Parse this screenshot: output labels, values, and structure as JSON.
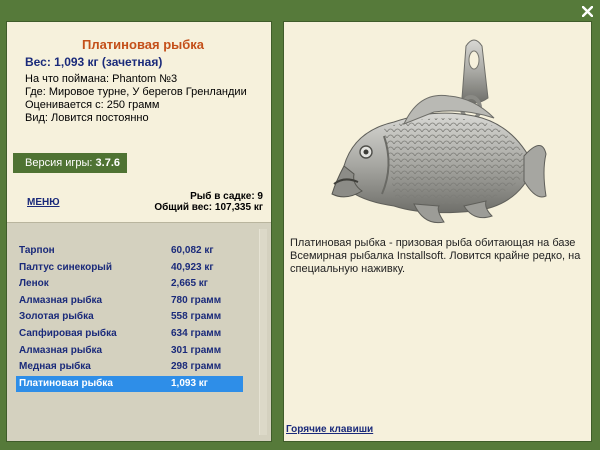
{
  "window": {
    "close_label": "X"
  },
  "fish": {
    "title": "Платиновая рыбка",
    "weight": "Вес: 1,093 кг (зачетная)",
    "info": [
      "На что поймана: Phantom №3",
      "Где: Мировое турне, У берегов Гренландии",
      "Оценивается с: 250 грамм",
      "Вид: Ловится постоянно"
    ],
    "description": "Платиновая рыбка - призовая рыба обитающая на базе Всемирная рыбалка Installsoft. Ловится крайне редко, на специальную наживку."
  },
  "version": {
    "label": "Версия игры:",
    "value": "3.7.6"
  },
  "menu_label": "МЕНЮ",
  "cage": {
    "count": "Рыб в садке: 9",
    "total": "Общий вес: 107,335 кг"
  },
  "fish_list": [
    {
      "name": "Тарпон",
      "weight": "60,082 кг"
    },
    {
      "name": "Палтус синекорый",
      "weight": "40,923 кг"
    },
    {
      "name": "Ленок",
      "weight": "2,665 кг"
    },
    {
      "name": "Алмазная рыбка",
      "weight": "780 грамм"
    },
    {
      "name": "Золотая рыбка",
      "weight": "558 грамм"
    },
    {
      "name": "Сапфировая рыбка",
      "weight": "634 грамм"
    },
    {
      "name": "Алмазная рыбка",
      "weight": "301 грамм"
    },
    {
      "name": "Медная рыбка",
      "weight": "298 грамм"
    },
    {
      "name": "Платиновая рыбка",
      "weight": "1,093 кг"
    }
  ],
  "selected_index": 8,
  "hotkeys_label": "Горячие клавиши",
  "colors": {
    "background": "#567a3a",
    "panel": "#f6f1dc",
    "title": "#c4501a",
    "link": "#1a2a7a",
    "selection": "#2e8ee8"
  }
}
